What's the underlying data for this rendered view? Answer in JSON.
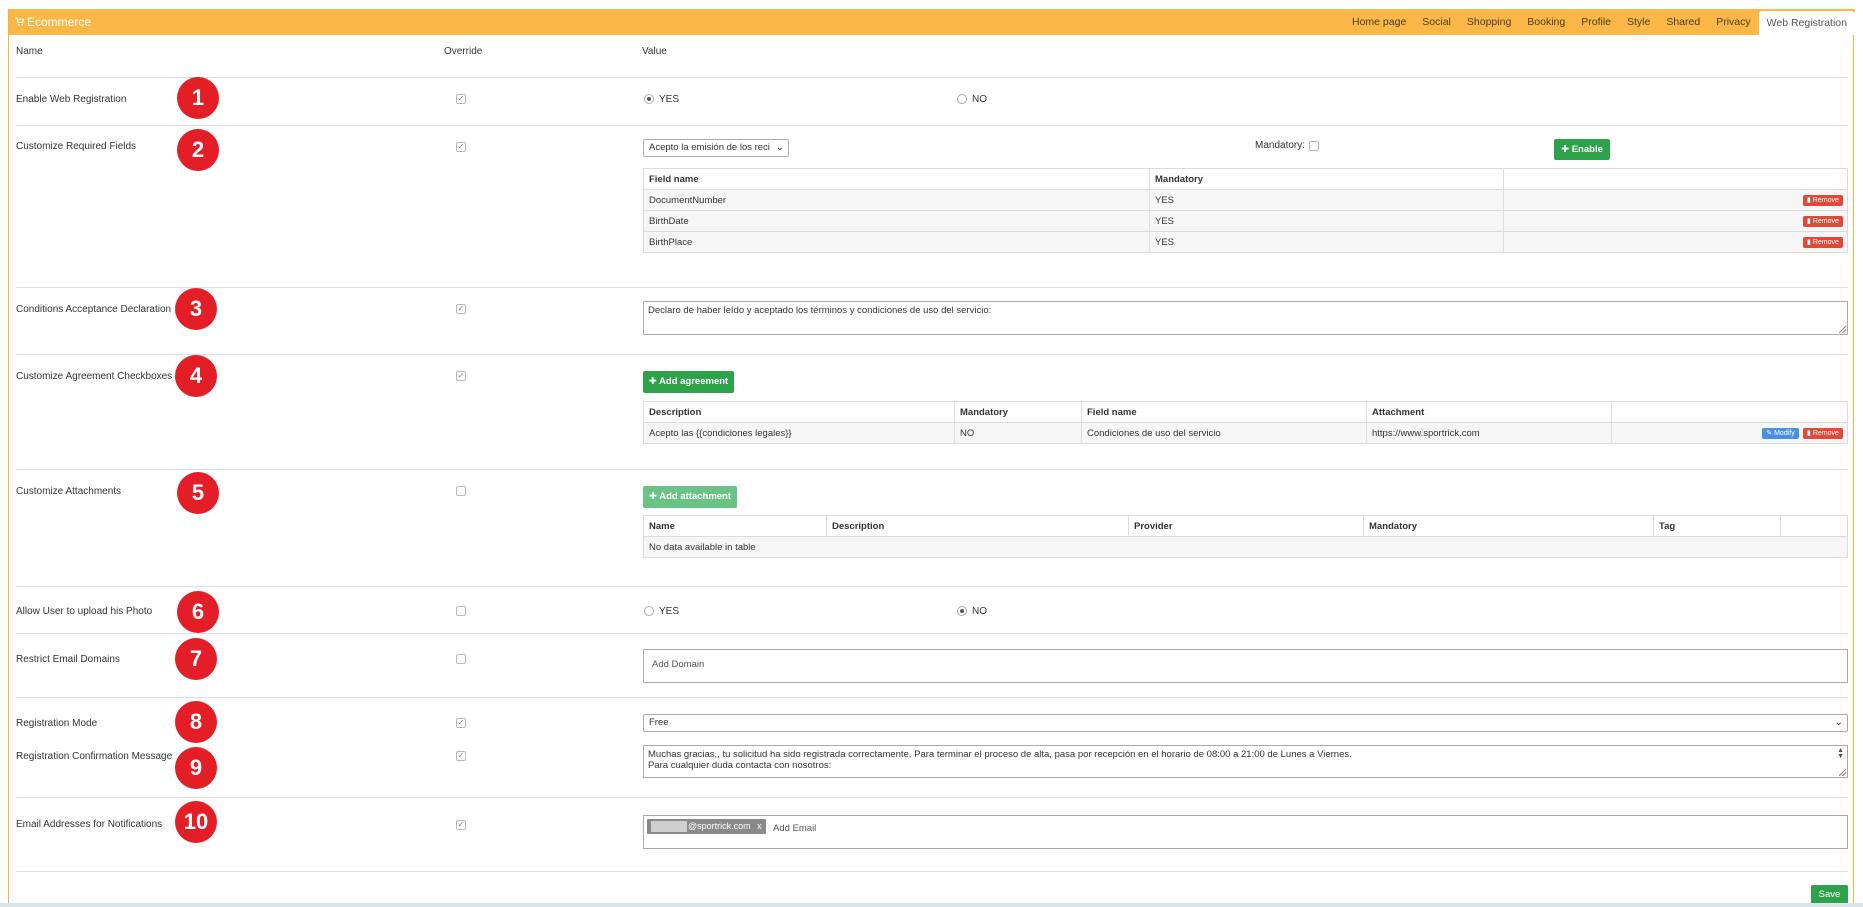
{
  "header": {
    "title": "Ecommerce",
    "tabs": [
      "Home page",
      "Social",
      "Shopping",
      "Booking",
      "Profile",
      "Style",
      "Shared",
      "Privacy",
      "Web Registration"
    ]
  },
  "columns": {
    "name": "Name",
    "override": "Override",
    "value": "Value"
  },
  "badges": [
    "1",
    "2",
    "3",
    "4",
    "5",
    "6",
    "7",
    "8",
    "9",
    "10"
  ],
  "rows": {
    "enable_web_registration": {
      "label": "Enable Web Registration",
      "override": true,
      "yes": "YES",
      "no": "NO",
      "selected": "YES"
    },
    "customize_required_fields": {
      "label": "Customize Required Fields",
      "override": true,
      "select_value": "Acepto la emisión de los reci",
      "mandatory_label": "Mandatory:",
      "enable_button": "Enable",
      "table_headers": [
        "Field name",
        "Mandatory",
        ""
      ],
      "table_rows": [
        {
          "field": "DocumentNumber",
          "mandatory": "YES",
          "action": "Remove"
        },
        {
          "field": "BirthDate",
          "mandatory": "YES",
          "action": "Remove"
        },
        {
          "field": "BirthPlace",
          "mandatory": "YES",
          "action": "Remove"
        }
      ]
    },
    "conditions_acceptance": {
      "label": "Conditions Acceptance Declaration",
      "override": true,
      "text": "Declaro de haber leído y aceptado los términos y condiciones de uso del servicio:"
    },
    "agreement_checkboxes": {
      "label": "Customize Agreement Checkboxes",
      "override": true,
      "add_button": "Add agreement",
      "table_headers": [
        "Description",
        "Mandatory",
        "Field name",
        "Attachment",
        ""
      ],
      "table_rows": [
        {
          "description": "Acepto las {{condiciones legales}}",
          "mandatory": "NO",
          "field": "Condiciones de uso del servicio",
          "attachment": "https://www.sportrick.com",
          "modify": "Modify",
          "remove": "Remove"
        }
      ]
    },
    "attachments": {
      "label": "Customize Attachments",
      "override": false,
      "add_button": "Add attachment",
      "table_headers": [
        "Name",
        "Description",
        "Provider",
        "Mandatory",
        "Tag",
        ""
      ],
      "empty_text": "No data available in table"
    },
    "upload_photo": {
      "label": "Allow User to upload his Photo",
      "override": false,
      "yes": "YES",
      "no": "NO",
      "selected": "NO"
    },
    "restrict_domains": {
      "label": "Restrict Email Domains",
      "override": false,
      "placeholder": "Add Domain"
    },
    "registration_mode": {
      "label": "Registration Mode",
      "override": true,
      "value": "Free"
    },
    "confirmation_message": {
      "label": "Registration Confirmation Message",
      "override": true,
      "line1": "Muchas gracias,, tu solicitud ha sido registrada correctamente. Para terminar el proceso de alta, pasa por recepción en el horario de 08:00 a 21:00 de Lunes a Viernes.",
      "line2": "Para cualquier duda contacta con nosotros:"
    },
    "notification_emails": {
      "label": "Email Addresses for Notifications",
      "override": true,
      "tag": "@sportrick.com",
      "tag_close": "x",
      "placeholder": "Add Email"
    }
  },
  "footer": {
    "save": "Save"
  },
  "icons": {
    "cart": "cart-icon",
    "plus": "plus-icon",
    "trash": "trash-icon",
    "edit": "edit-icon",
    "check": "check-icon"
  },
  "colors": {
    "header": "#fbb847",
    "badge": "#e41e26",
    "green": "#2da24a",
    "red": "#e04a3a",
    "blue": "#4a90e2"
  }
}
